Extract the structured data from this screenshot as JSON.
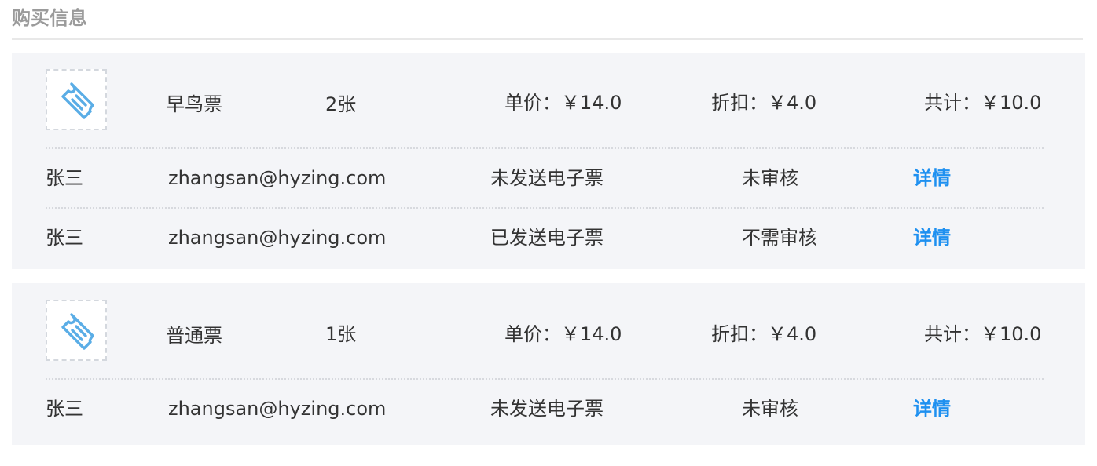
{
  "header": {
    "title": "购买信息"
  },
  "colors": {
    "title_text": "#9b9b9b",
    "card_background": "#f4f5f8",
    "detail_link": "#1e90f0",
    "ticket_icon_stroke": "#5aade6"
  },
  "tickets": [
    {
      "icon": "ticket-icon",
      "name": "早鸟票",
      "quantity": "2张",
      "unit_price": "单价：￥14.0",
      "discount": "折扣：￥4.0",
      "total": "共计：￥10.0",
      "attendees": [
        {
          "name": "张三",
          "email": "zhangsan@hyzing.com",
          "eticket_status": "未发送电子票",
          "audit_status": "未审核",
          "detail_label": "详情"
        },
        {
          "name": "张三",
          "email": "zhangsan@hyzing.com",
          "eticket_status": "已发送电子票",
          "audit_status": "不需审核",
          "detail_label": "详情"
        }
      ]
    },
    {
      "icon": "ticket-icon",
      "name": "普通票",
      "quantity": "1张",
      "unit_price": "单价：￥14.0",
      "discount": "折扣：￥4.0",
      "total": "共计：￥10.0",
      "attendees": [
        {
          "name": "张三",
          "email": "zhangsan@hyzing.com",
          "eticket_status": "未发送电子票",
          "audit_status": "未审核",
          "detail_label": "详情"
        }
      ]
    }
  ]
}
